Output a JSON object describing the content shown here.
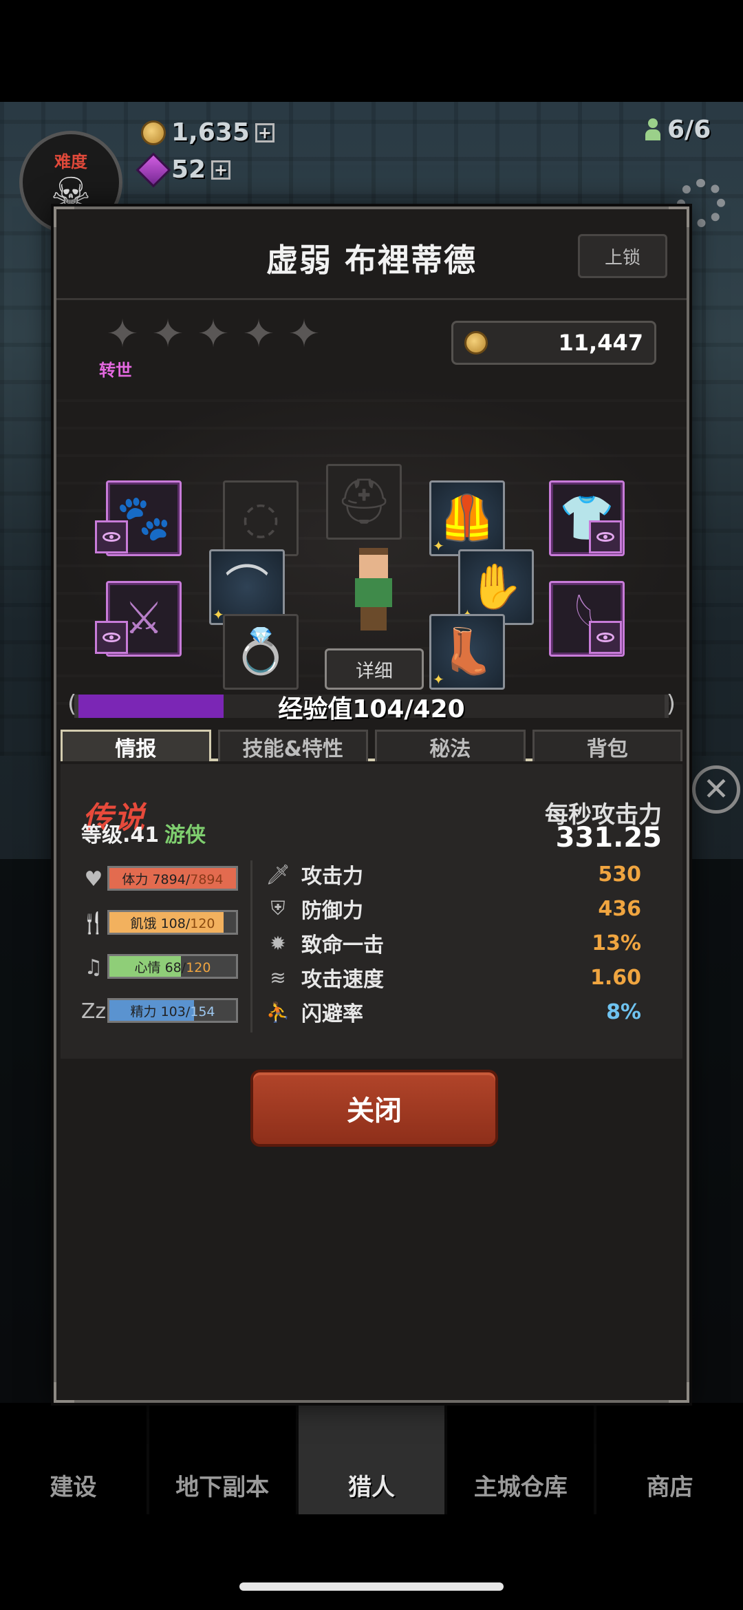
{
  "hud": {
    "coins": "1,635",
    "gems": "52",
    "population": "6/6",
    "difficulty_label": "难度"
  },
  "dialog": {
    "title": "虚弱 布裡蒂德",
    "lock_label": "上锁",
    "rebirth_label": "转世",
    "star_count": 5,
    "gold": "11,447",
    "detail_label": "详细",
    "exp": {
      "text": "经验值104/420",
      "current": 104,
      "max": 420
    },
    "tabs": [
      {
        "label": "情报",
        "active": true
      },
      {
        "label": "技能&特性",
        "active": false
      },
      {
        "label": "秘法",
        "active": false
      },
      {
        "label": "背包",
        "active": false
      }
    ],
    "info": {
      "rarity": "传说",
      "level_text": "等级.41",
      "class_text": "游侠",
      "dps_label": "每秒攻击力",
      "dps_value": "331.25",
      "needs": [
        {
          "name": "体力",
          "current": "7894",
          "max": "7894",
          "fraction": 1.0,
          "color": "#e36b4f",
          "icon": "heart-icon"
        },
        {
          "name": "飢饿",
          "current": "108",
          "max": "120",
          "fraction": 0.9,
          "color": "#f2b15e",
          "icon": "fork-knife-icon"
        },
        {
          "name": "心情",
          "current": "68",
          "max": "120",
          "fraction": 0.567,
          "color": "#8fce78",
          "icon": "music-note-icon"
        },
        {
          "name": "精力",
          "current": "103",
          "max": "154",
          "fraction": 0.669,
          "color": "#5a93d0",
          "icon": "sleep-icon"
        }
      ],
      "stats": [
        {
          "name": "攻击力",
          "value": "530",
          "color": "#f0a540",
          "icon": "sword-icon"
        },
        {
          "name": "防御力",
          "value": "436",
          "color": "#f0a540",
          "icon": "shield-icon"
        },
        {
          "name": "致命一击",
          "value": "13%",
          "color": "#f0a540",
          "icon": "critical-icon"
        },
        {
          "name": "攻击速度",
          "value": "1.60",
          "color": "#f0a540",
          "icon": "speed-icon"
        },
        {
          "name": "闪避率",
          "value": "8%",
          "color": "#6fc3f0",
          "icon": "dodge-icon"
        }
      ]
    },
    "close_label": "关闭"
  },
  "bottom_nav": [
    {
      "label": "建设"
    },
    {
      "label": "地下副本"
    },
    {
      "label": "猎人",
      "active": true
    },
    {
      "label": "主城仓库"
    },
    {
      "label": "商店"
    }
  ],
  "colors": {
    "exp_fill": "#7b26b5",
    "legend_text": "#e74a3b",
    "class_text": "#7fcf6f",
    "rebirth_text": "#e468e0",
    "close_button": "#a33d24"
  }
}
